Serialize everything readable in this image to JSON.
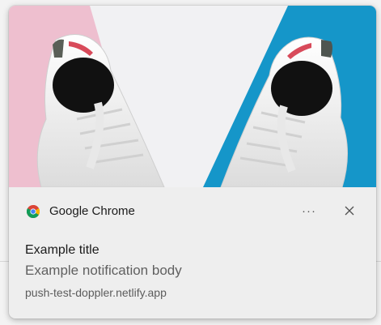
{
  "notification": {
    "app_name": "Google Chrome",
    "title": "Example title",
    "body": "Example notification body",
    "origin": "push-test-doppler.netlify.app",
    "more_label": "···",
    "app_icon": "chrome-icon",
    "close_icon": "close-icon",
    "hero_image": "white-sneakers-on-pink-white-blue-background"
  },
  "colors": {
    "toast_background": "#eeeeee",
    "hero_pink": "#eebfcf",
    "hero_white": "#f1f1f3",
    "hero_blue": "#1596c9"
  }
}
